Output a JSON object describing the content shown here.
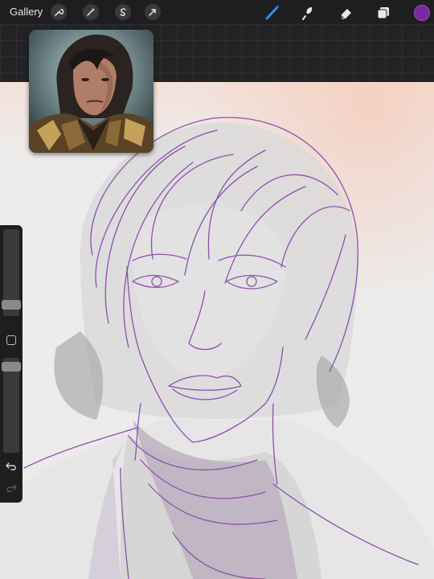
{
  "toolbar": {
    "gallery_label": "Gallery",
    "left_tools": [
      "wrench-icon",
      "magic-wand-icon",
      "selection-s-icon",
      "transform-arrow-icon"
    ],
    "right_tools": [
      "brush-icon",
      "smudge-icon",
      "eraser-icon",
      "layers-icon"
    ],
    "active_tool": "brush-icon",
    "active_color": "#7a2a9c"
  },
  "reference_window": {
    "icon": "reference-portrait"
  },
  "sidebar": {
    "brush_size": 0.28,
    "opacity": 0.55,
    "undo_icon": "undo-arrow-icon",
    "redo_icon": "redo-arrow-icon"
  },
  "canvas": {
    "sketch_color": "#8e4fae"
  }
}
